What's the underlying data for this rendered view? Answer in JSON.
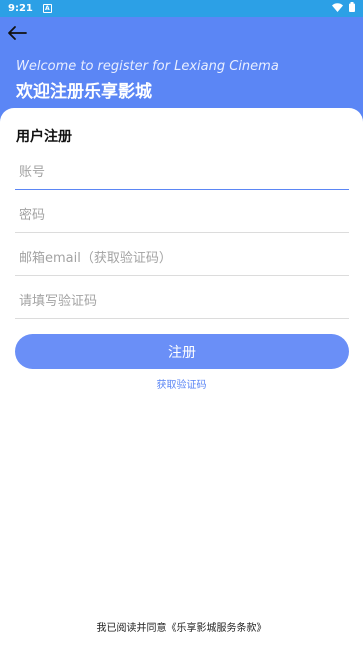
{
  "status_bar": {
    "time": "9:21",
    "notification": "A",
    "icons": [
      "wifi-icon",
      "battery-icon"
    ]
  },
  "header": {
    "back_icon": "arrow-left-icon",
    "welcome_en": "Welcome to register for Lexiang Cinema",
    "welcome_cn": "欢迎注册乐享影城",
    "color": "#5b86f5"
  },
  "form": {
    "title": "用户注册",
    "account_placeholder": "账号",
    "password_placeholder": "密码",
    "email_placeholder": "邮箱email（获取验证码）",
    "code_placeholder": "请填写验证码",
    "submit_label": "注册",
    "get_code_label": "获取验证码"
  },
  "footer": {
    "agreement": "我已阅读并同意《乐享影城服务条款》"
  }
}
